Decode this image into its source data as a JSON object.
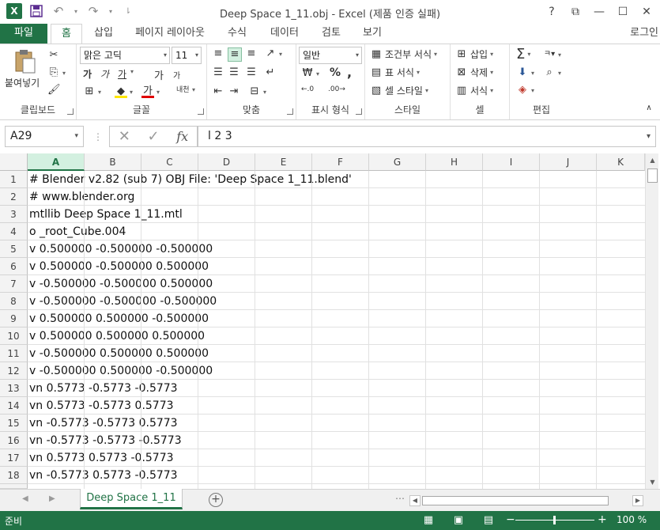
{
  "window": {
    "title": "Deep Space 1_11.obj - Excel (제품 인증 실패)",
    "app_icon_letter": "X",
    "controls": [
      "?",
      "⧉",
      "—",
      "☐",
      "✕"
    ]
  },
  "tabs": {
    "file": "파일",
    "items": [
      "홈",
      "삽입",
      "페이지 레이아웃",
      "수식",
      "데이터",
      "검토",
      "보기"
    ],
    "active": "홈",
    "login": "로그인"
  },
  "ribbon": {
    "clipboard": {
      "paste": "붙여넣기",
      "label": "클립보드"
    },
    "font": {
      "family": "맑은 고딕",
      "size": "11",
      "label": "글꼴",
      "bold": "가",
      "italic": "가",
      "underline": "가",
      "grow": "가",
      "shrink": "가",
      "phonetic": "내천"
    },
    "alignment": {
      "label": "맞춤"
    },
    "number": {
      "format": "일반",
      "percent": "%",
      "comma": ",",
      "label": "표시 형식"
    },
    "styles": {
      "conditional": "조건부 서식",
      "table": "표 서식",
      "cell": "셀 스타일",
      "label": "스타일"
    },
    "cells": {
      "insert": "삽입",
      "delete": "삭제",
      "format": "서식",
      "label": "셀"
    },
    "editing": {
      "label": "편집",
      "sum": "Σ",
      "sort": "ㅋ"
    }
  },
  "formula_bar": {
    "name_box": "A29",
    "fx": "fx",
    "content": "l 2 3"
  },
  "grid": {
    "columns": [
      "A",
      "B",
      "C",
      "D",
      "E",
      "F",
      "G",
      "H",
      "I",
      "J",
      "K"
    ],
    "selected_column": "A",
    "rows": [
      {
        "n": "1",
        "a": "# Blender v2.82 (sub 7) OBJ File: 'Deep Space 1_11.blend'"
      },
      {
        "n": "2",
        "a": "# www.blender.org"
      },
      {
        "n": "3",
        "a": "mtllib Deep Space 1_11.mtl"
      },
      {
        "n": "4",
        "a": "o _root_Cube.004"
      },
      {
        "n": "5",
        "a": "v 0.500000 -0.500000 -0.500000"
      },
      {
        "n": "6",
        "a": "v 0.500000 -0.500000 0.500000"
      },
      {
        "n": "7",
        "a": "v -0.500000 -0.500000 0.500000"
      },
      {
        "n": "8",
        "a": "v -0.500000 -0.500000 -0.500000"
      },
      {
        "n": "9",
        "a": "v 0.500000 0.500000 -0.500000"
      },
      {
        "n": "10",
        "a": "v 0.500000 0.500000 0.500000"
      },
      {
        "n": "11",
        "a": "v -0.500000 0.500000 0.500000"
      },
      {
        "n": "12",
        "a": "v -0.500000 0.500000 -0.500000"
      },
      {
        "n": "13",
        "a": "vn 0.5773 -0.5773 -0.5773"
      },
      {
        "n": "14",
        "a": "vn 0.5773 -0.5773 0.5773"
      },
      {
        "n": "15",
        "a": "vn -0.5773 -0.5773 0.5773"
      },
      {
        "n": "16",
        "a": "vn -0.5773 -0.5773 -0.5773"
      },
      {
        "n": "17",
        "a": "vn 0.5773 0.5773 -0.5773"
      },
      {
        "n": "18",
        "a": "vn -0.5773 0.5773 -0.5773"
      }
    ]
  },
  "sheets": {
    "active": "Deep Space 1_11",
    "dots": "⋯"
  },
  "status": {
    "text": "준비",
    "zoom": "100 %"
  },
  "colors": {
    "accent": "#217346",
    "header_bg": "#f3f3f3",
    "selected_header": "#d3f0e0"
  }
}
